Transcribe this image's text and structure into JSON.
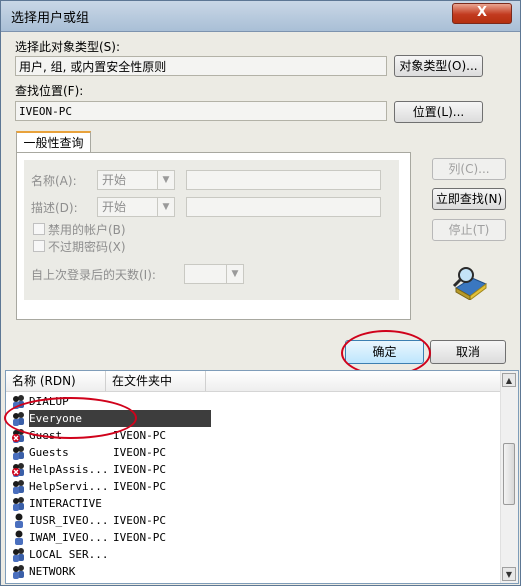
{
  "title": "选择用户或组",
  "close_symbol": "X",
  "object_type": {
    "label": "选择此对象类型(S):",
    "value": "用户, 组, 或内置安全性原则",
    "button": "对象类型(O)..."
  },
  "location": {
    "label": "查找位置(F):",
    "value": "IVEON-PC",
    "button": "位置(L)..."
  },
  "tab": "一般性查询",
  "query": {
    "name_label": "名称(A):",
    "name_mode": "开始",
    "desc_label": "描述(D):",
    "desc_mode": "开始",
    "disabled_accounts": "禁用的帐户(B)",
    "non_expiring": "不过期密码(X)",
    "days_label": "自上次登录后的天数(I):"
  },
  "side_buttons": {
    "columns": "列(C)...",
    "find_now": "立即查找(N)",
    "stop": "停止(T)"
  },
  "ok": "确定",
  "cancel": "取消",
  "results": {
    "columns": [
      "名称 (RDN)",
      "在文件夹中"
    ],
    "rows": [
      {
        "name": "DIALUP",
        "folder": "",
        "icon": "group-icon"
      },
      {
        "name": "Everyone",
        "folder": "",
        "icon": "group-icon",
        "selected": true
      },
      {
        "name": "Guest",
        "folder": "IVEON-PC",
        "icon": "disabled-user-icon"
      },
      {
        "name": "Guests",
        "folder": "IVEON-PC",
        "icon": "group-icon"
      },
      {
        "name": "HelpAssis...",
        "folder": "IVEON-PC",
        "icon": "disabled-user-icon"
      },
      {
        "name": "HelpServi...",
        "folder": "IVEON-PC",
        "icon": "group-icon"
      },
      {
        "name": "INTERACTIVE",
        "folder": "",
        "icon": "group-icon"
      },
      {
        "name": "IUSR_IVEO...",
        "folder": "IVEON-PC",
        "icon": "user-icon"
      },
      {
        "name": "IWAM_IVEO...",
        "folder": "IVEON-PC",
        "icon": "user-icon"
      },
      {
        "name": "LOCAL SER...",
        "folder": "",
        "icon": "group-icon"
      },
      {
        "name": "NETWORK",
        "folder": "",
        "icon": "group-icon"
      }
    ]
  },
  "annotation_color": "#d0021b",
  "selection_color": "#3d3d3d"
}
